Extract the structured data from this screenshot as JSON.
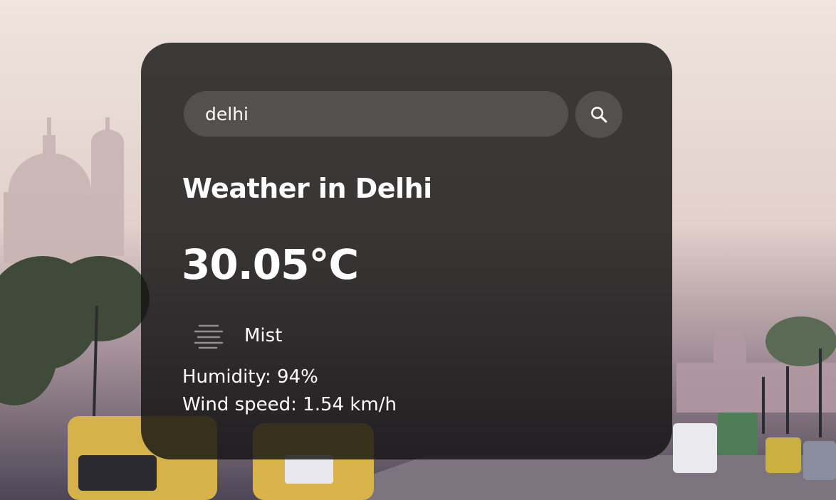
{
  "search": {
    "value": "delhi",
    "button_icon": "search-icon"
  },
  "weather": {
    "title": "Weather in Delhi",
    "temperature": "30.05°C",
    "condition_icon": "mist-icon",
    "condition": "Mist",
    "humidity": "Humidity: 94%",
    "wind": "Wind speed: 1.54 km/h"
  },
  "colors": {
    "card_background": "#141414",
    "text": "#ffffff"
  }
}
